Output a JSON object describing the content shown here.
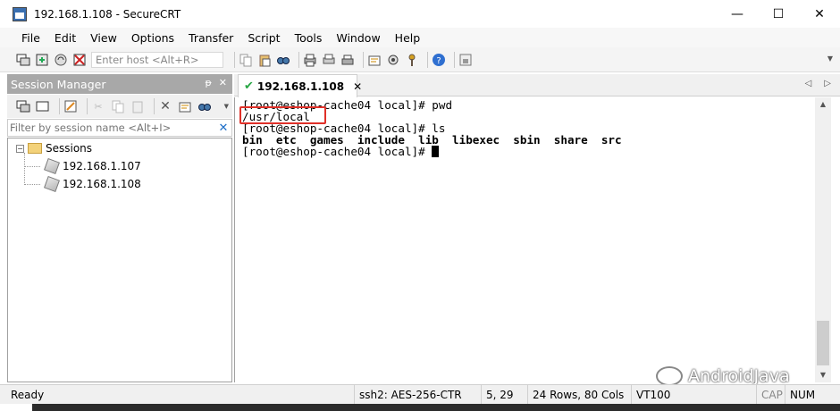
{
  "window": {
    "title": "192.168.1.108 - SecureCRT",
    "minimize": "—",
    "maximize": "☐",
    "close": "✕"
  },
  "menu": [
    "File",
    "Edit",
    "View",
    "Options",
    "Transfer",
    "Script",
    "Tools",
    "Window",
    "Help"
  ],
  "toolbar": {
    "host_placeholder": "Enter host <Alt+R>"
  },
  "session_manager": {
    "title": "Session Manager",
    "pin": "ᵽ",
    "close": "✕",
    "filter_placeholder": "Filter by session name <Alt+I>",
    "filter_clear": "✕",
    "root": "Sessions",
    "expander": "−",
    "sessions": [
      "192.168.1.107",
      "192.168.1.108"
    ]
  },
  "tab": {
    "label": "192.168.1.108",
    "close": "✕",
    "prev": "◁",
    "next": "▷"
  },
  "terminal": {
    "lines": [
      "[root@eshop-cache04 local]# pwd",
      "/usr/local",
      "[root@eshop-cache04 local]# ls",
      "bin  etc  games  include  lib  libexec  sbin  share  src",
      "[root@eshop-cache04 local]# "
    ],
    "highlight_color": "#e03028"
  },
  "watermark": "AndroidJava",
  "status": {
    "ready": "Ready",
    "protocol": "ssh2: AES-256-CTR",
    "cursor_pos": "5,  29",
    "size": "24 Rows, 80 Cols",
    "term_type": "VT100",
    "caps": "CAP",
    "num": "NUM"
  }
}
